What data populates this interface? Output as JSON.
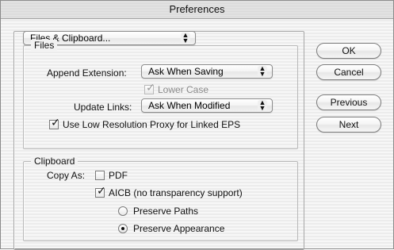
{
  "window": {
    "title": "Preferences"
  },
  "panel_selector": {
    "value": "Files & Clipboard..."
  },
  "files": {
    "label": "Files",
    "append_extension_label": "Append Extension:",
    "append_extension_value": "Ask When Saving",
    "lower_case_label": "Lower Case",
    "update_links_label": "Update Links:",
    "update_links_value": "Ask When Modified",
    "low_res_proxy_label": "Use Low Resolution Proxy for Linked EPS"
  },
  "clipboard": {
    "label": "Clipboard",
    "copy_as_label": "Copy As:",
    "pdf_label": "PDF",
    "aicb_label": "AICB (no transparency support)",
    "preserve_paths_label": "Preserve Paths",
    "preserve_appearance_label": "Preserve Appearance"
  },
  "buttons": {
    "ok": "OK",
    "cancel": "Cancel",
    "previous": "Previous",
    "next": "Next"
  },
  "icons": {
    "popup_arrows": "popup-arrows-icon",
    "checkmark": "checkmark-icon",
    "radio_dot": "radio-dot-icon"
  }
}
